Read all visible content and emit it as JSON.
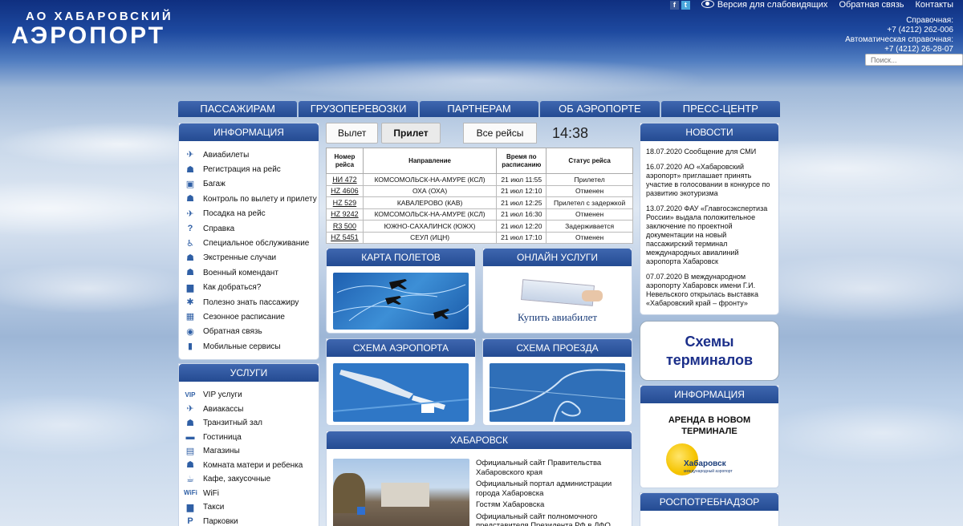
{
  "header": {
    "logo_line1": "АО ХАБАРОВСКИЙ",
    "logo_line2": "АЭРОПОРТ",
    "links": {
      "accessibility": "Версия для слабовидящих",
      "feedback": "Обратная связь",
      "contacts": "Контакты"
    },
    "contacts": {
      "help_label": "Справочная:",
      "help_phone": "+7 (4212) 262-006",
      "auto_label": "Автоматическая справочная:",
      "auto_phone": "+7 (4212) 26-28-07"
    },
    "search_placeholder": "Поиск..."
  },
  "nav": [
    "ПАССАЖИРАМ",
    "ГРУЗОПЕРЕВОЗКИ",
    "ПАРТНЕРАМ",
    "ОБ АЭРОПОРТЕ",
    "ПРЕСС-ЦЕНТР"
  ],
  "info_panel": {
    "title": "ИНФОРМАЦИЯ",
    "items": [
      {
        "label": "Авиабилеты",
        "icon": "ticket-icon",
        "glyph": "✈"
      },
      {
        "label": "Регистрация на рейс",
        "icon": "checkin-icon",
        "glyph": "☗"
      },
      {
        "label": "Багаж",
        "icon": "luggage-icon",
        "glyph": "▣"
      },
      {
        "label": "Контроль по вылету и прилету",
        "icon": "control-icon",
        "glyph": "☗"
      },
      {
        "label": "Посадка на рейс",
        "icon": "boarding-icon",
        "glyph": "✈"
      },
      {
        "label": "Справка",
        "icon": "help-icon",
        "glyph": "?"
      },
      {
        "label": "Специальное обслуживание",
        "icon": "wheelchair-icon",
        "glyph": "♿"
      },
      {
        "label": "Экстренные случаи",
        "icon": "emergency-icon",
        "glyph": "☗"
      },
      {
        "label": "Военный комендант",
        "icon": "military-icon",
        "glyph": "☗"
      },
      {
        "label": "Как добраться?",
        "icon": "bus-icon",
        "glyph": "▆"
      },
      {
        "label": "Полезно знать пассажиру",
        "icon": "info-icon",
        "glyph": "✱"
      },
      {
        "label": "Сезонное расписание",
        "icon": "calendar-icon",
        "glyph": "▦"
      },
      {
        "label": "Обратная связь",
        "icon": "feedback-icon",
        "glyph": "◉"
      },
      {
        "label": "Мобильные сервисы",
        "icon": "mobile-icon",
        "glyph": "▮"
      }
    ]
  },
  "services_panel": {
    "title": "УСЛУГИ",
    "items": [
      {
        "label": "VIP услуги",
        "icon": "vip-icon",
        "glyph": "VIP"
      },
      {
        "label": "Авиакассы",
        "icon": "cashdesk-icon",
        "glyph": "✈"
      },
      {
        "label": "Транзитный зал",
        "icon": "transit-icon",
        "glyph": "☗"
      },
      {
        "label": "Гостиница",
        "icon": "hotel-icon",
        "glyph": "▬"
      },
      {
        "label": "Магазины",
        "icon": "shop-icon",
        "glyph": "▤"
      },
      {
        "label": "Комната матери и ребенка",
        "icon": "mother-child-icon",
        "glyph": "☗"
      },
      {
        "label": "Кафе, закусочные",
        "icon": "cafe-icon",
        "glyph": "☕"
      },
      {
        "label": "WiFi",
        "icon": "wifi-icon",
        "glyph": "WiFi"
      },
      {
        "label": "Такси",
        "icon": "taxi-icon",
        "glyph": "▆"
      },
      {
        "label": "Парковки",
        "icon": "parking-icon",
        "glyph": "P"
      }
    ]
  },
  "flights": {
    "tab_departure": "Вылет",
    "tab_arrival": "Прилет",
    "all_flights": "Все рейсы",
    "time": "14:38",
    "columns": [
      "Номер рейса",
      "Направление",
      "Время по расписанию",
      "Статус рейса"
    ],
    "rows": [
      {
        "num": "НИ 472",
        "dest": "КОМСОМОЛЬСК-НА-АМУРЕ (КСЛ)",
        "time": "21 июл 11:55",
        "status": "Прилетел"
      },
      {
        "num": "HZ 4606",
        "dest": "ОХА (ОХА)",
        "time": "21 июл 12:10",
        "status": "Отменен"
      },
      {
        "num": "HZ 529",
        "dest": "КАВАЛЕРОВО (КАВ)",
        "time": "21 июл 12:25",
        "status": "Прилетел с задержкой"
      },
      {
        "num": "HZ 9242",
        "dest": "КОМСОМОЛЬСК-НА-АМУРЕ (КСЛ)",
        "time": "21 июл 16:30",
        "status": "Отменен"
      },
      {
        "num": "R3 500",
        "dest": "ЮЖНО-САХАЛИНСК (ЮЖХ)",
        "time": "21 июл 12:20",
        "status": "Задерживается"
      },
      {
        "num": "HZ 5451",
        "dest": "СЕУЛ (ИЦН)",
        "time": "21 июл 17:10",
        "status": "Отменен"
      }
    ]
  },
  "tiles": {
    "map": "КАРТА ПОЛЕТОВ",
    "online": "ОНЛАЙН УСЛУГИ",
    "buy_ticket": "Купить авиабилет",
    "airport_scheme": "СХЕМА АЭРОПОРТА",
    "route_scheme": "СХЕМА ПРОЕЗДА",
    "city": "ХАБАРОВСК"
  },
  "city_links": [
    "Официальный сайт Правительства Хабаровского края",
    "Официальный портал администрации города Хабаровска",
    "Гостям Хабаровска",
    "Официальный сайт полномочного представителя Президента РФ в ДФО"
  ],
  "news": {
    "title": "НОВОСТИ",
    "items": [
      "18.07.2020 Сообщение для СМИ",
      "16.07.2020 АО «Хабаровский аэропорт» приглашает принять участие в голосовании в конкурсе по развитию экотуризма",
      "13.07.2020 ФАУ «Главгосэкспертиза России» выдала положительное заключение по проектной документации на новый пассажирский терминал международных авиалиний аэропорта Хабаровск",
      "07.07.2020 В международном аэропорту Хабаровск имени Г.И. Невельского открылась выставка «Хабаровский край – фронту»"
    ]
  },
  "schemes_banner": "Схемы терминалов",
  "info_right": {
    "title": "ИНФОРМАЦИЯ",
    "text": "АРЕНДА В НОВОМ ТЕРМИНАЛЕ",
    "logo_name": "Хабаровск",
    "logo_sub": "международный аэропорт"
  },
  "rpn": {
    "title": "РОСПОТРЕБНАДЗОР"
  }
}
